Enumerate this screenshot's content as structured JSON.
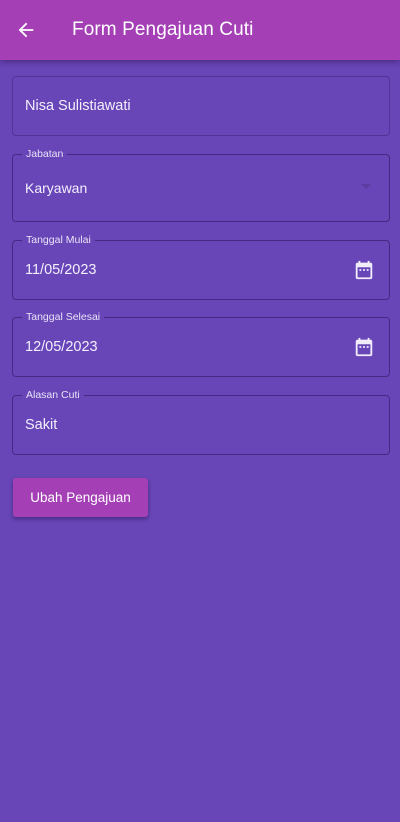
{
  "app_bar": {
    "title": "Form Pengajuan Cuti",
    "back_icon": "arrow-left-icon",
    "color": "#a53fb6"
  },
  "form": {
    "name": {
      "value": "Nisa Sulistiawati"
    },
    "jabatan": {
      "label": "Jabatan",
      "value": "Karyawan",
      "icon": "dropdown-arrow-icon"
    },
    "tanggal_mulai": {
      "label": "Tanggal Mulai",
      "value": "11/05/2023",
      "icon": "calendar-icon"
    },
    "tanggal_selesai": {
      "label": "Tanggal Selesai",
      "value": "12/05/2023",
      "icon": "calendar-icon"
    },
    "alasan_cuti": {
      "label": "Alasan Cuti",
      "value": "Sakit"
    },
    "submit_label": "Ubah Pengajuan"
  },
  "colors": {
    "background": "#6846b8",
    "accent": "#a53fb6"
  }
}
